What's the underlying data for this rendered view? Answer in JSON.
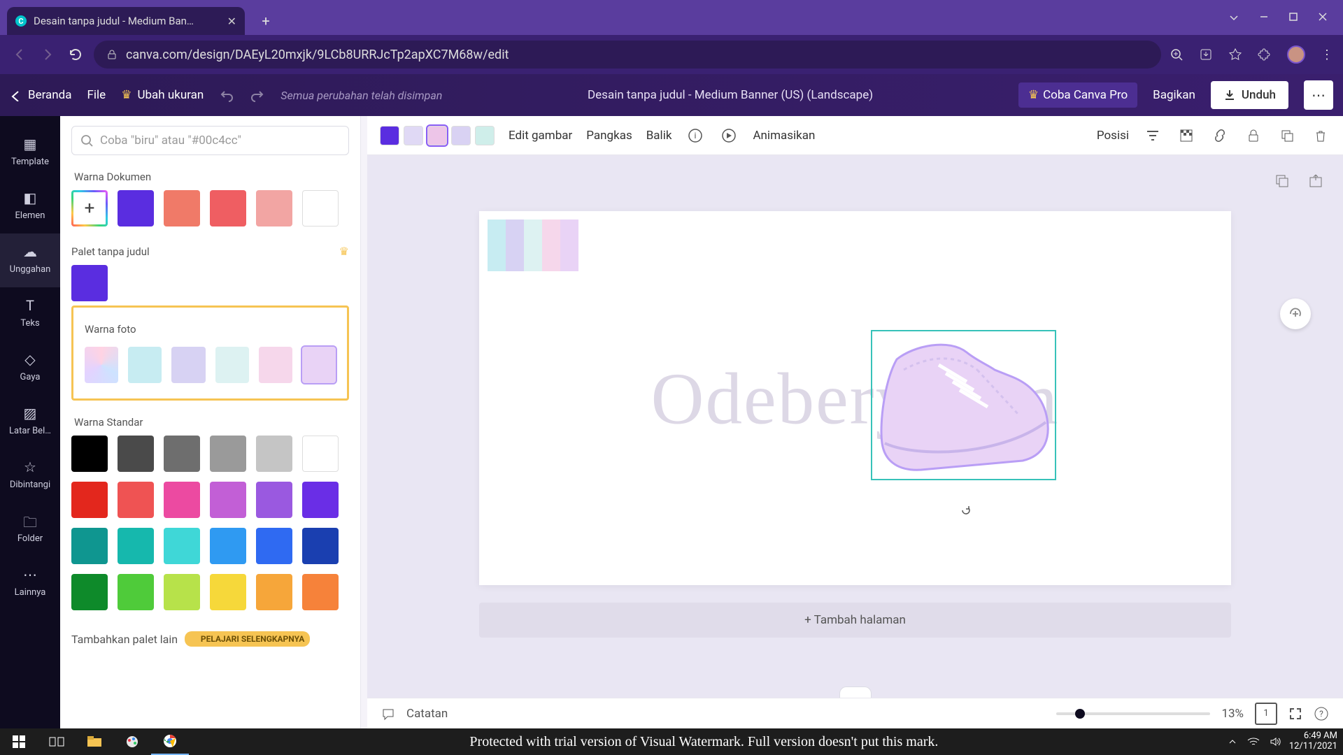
{
  "browser": {
    "tab_title": "Desain tanpa judul - Medium Ban…",
    "url": "canva.com/design/DAEyL20mxjk/9LCb8URRJcTp2apXC7M68w/edit"
  },
  "canva_bar": {
    "home": "Beranda",
    "file": "File",
    "resize": "Ubah ukuran",
    "status": "Semua perubahan telah disimpan",
    "title": "Desain tanpa judul - Medium Banner (US) (Landscape)",
    "try_pro": "Coba Canva Pro",
    "share": "Bagikan",
    "download": "Unduh"
  },
  "ctx": {
    "swatches": [
      "#5a2de0",
      "#e0d9f5",
      "#edc5e8",
      "#d9d2f3",
      "#cfeeea"
    ],
    "edit_image": "Edit gambar",
    "crop": "Pangkas",
    "flip": "Balik",
    "animate": "Animasikan",
    "position": "Posisi"
  },
  "rail": {
    "items": [
      "Template",
      "Elemen",
      "Unggahan",
      "Teks",
      "Gaya",
      "Latar Bel…",
      "Dibintangi",
      "Folder",
      "Lainnya"
    ]
  },
  "panel": {
    "search_placeholder": "Coba \"biru\" atau \"#00c4cc\"",
    "sec_document": "Warna Dokumen",
    "doc_colors": [
      "#5a2de0",
      "#f07a68",
      "#ef5e62",
      "#f2a5a3",
      "#ffffff"
    ],
    "sec_palette": "Palet tanpa judul",
    "palette_colors": [
      "#5a2de0"
    ],
    "sec_photo": "Warna foto",
    "photo_colors": [
      "gradient",
      "#c7ecf2",
      "#d7d2f3",
      "#ddf2f2",
      "#f6d7eb",
      "#e9d3f6"
    ],
    "sec_standard": "Warna Standar",
    "standard_colors": [
      [
        "#000000",
        "#4a4a4a",
        "#6e6e6e",
        "#9a9a9a",
        "#c5c5c5",
        "#ffffff"
      ],
      [
        "#e3271d",
        "#ef5353",
        "#ec4aa1",
        "#c25fd6",
        "#9a59e0",
        "#6a2ee6"
      ],
      [
        "#0f9690",
        "#16b8ad",
        "#3fd7d7",
        "#2f9af2",
        "#2f6af2",
        "#1a3fb0"
      ],
      [
        "#0e8a2a",
        "#4fcb3a",
        "#b7e24a",
        "#f6d83a",
        "#f6a63a",
        "#f6823a"
      ]
    ],
    "add_palette": "Tambahkan palet lain",
    "learn_more": "PELAJARI SELENGKAPNYA"
  },
  "canvas": {
    "palette_colors": [
      "#c7ecf2",
      "#d7d2f3",
      "#ddf2f2",
      "#f6d7eb",
      "#e9d3f6"
    ],
    "watermark": "Odebery.com",
    "add_page": "+ Tambah halaman"
  },
  "footer": {
    "notes": "Catatan",
    "zoom": "13%",
    "page_count": "1"
  },
  "taskbar": {
    "msg": "Protected with trial version of Visual Watermark. Full version doesn't put this mark.",
    "time": "6:49 AM",
    "date": "12/11/2021"
  }
}
